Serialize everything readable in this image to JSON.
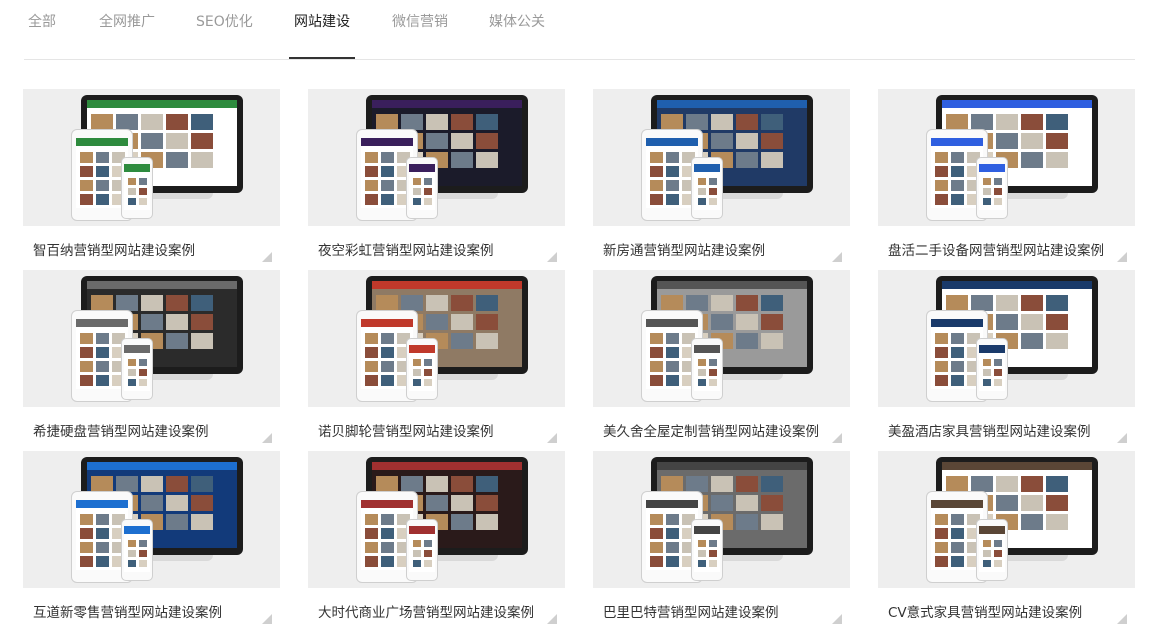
{
  "tabs": [
    {
      "label": "全部",
      "active": false
    },
    {
      "label": "全网推广",
      "active": false
    },
    {
      "label": "SEO优化",
      "active": false
    },
    {
      "label": "网站建设",
      "active": true
    },
    {
      "label": "微信营销",
      "active": false
    },
    {
      "label": "媒体公关",
      "active": false
    }
  ],
  "cases": [
    {
      "title": "智百纳营销型网站建设案例",
      "accent": "#2e8b3e",
      "bg": "#ffffff"
    },
    {
      "title": "夜空彩虹营销型网站建设案例",
      "accent": "#3a1f5c",
      "bg": "#1b1b2a"
    },
    {
      "title": "新房通营销型网站建设案例",
      "accent": "#1f5fae",
      "bg": "#203a66"
    },
    {
      "title": "盘活二手设备网营销型网站建设案例",
      "accent": "#2f5fe0",
      "bg": "#ffffff"
    },
    {
      "title": "希捷硬盘营销型网站建设案例",
      "accent": "#6a6a6a",
      "bg": "#2b2b2b"
    },
    {
      "title": "诺贝脚轮营销型网站建设案例",
      "accent": "#c0392b",
      "bg": "#8f7a64"
    },
    {
      "title": "美久舍全屋定制营销型网站建设案例",
      "accent": "#555555",
      "bg": "#9a9a9a"
    },
    {
      "title": "美盈酒店家具营销型网站建设案例",
      "accent": "#1a3a6a",
      "bg": "#ffffff"
    },
    {
      "title": "互道新零售营销型网站建设案例",
      "accent": "#1d6fd0",
      "bg": "#123a7a"
    },
    {
      "title": "大时代商业广场营销型网站建设案例",
      "accent": "#a03030",
      "bg": "#2a1a1a"
    },
    {
      "title": "巴里巴特营销型网站建设案例",
      "accent": "#444444",
      "bg": "#6b6b6b"
    },
    {
      "title": "CV意式家具营销型网站建设案例",
      "accent": "#5a4636",
      "bg": "#ffffff"
    }
  ]
}
